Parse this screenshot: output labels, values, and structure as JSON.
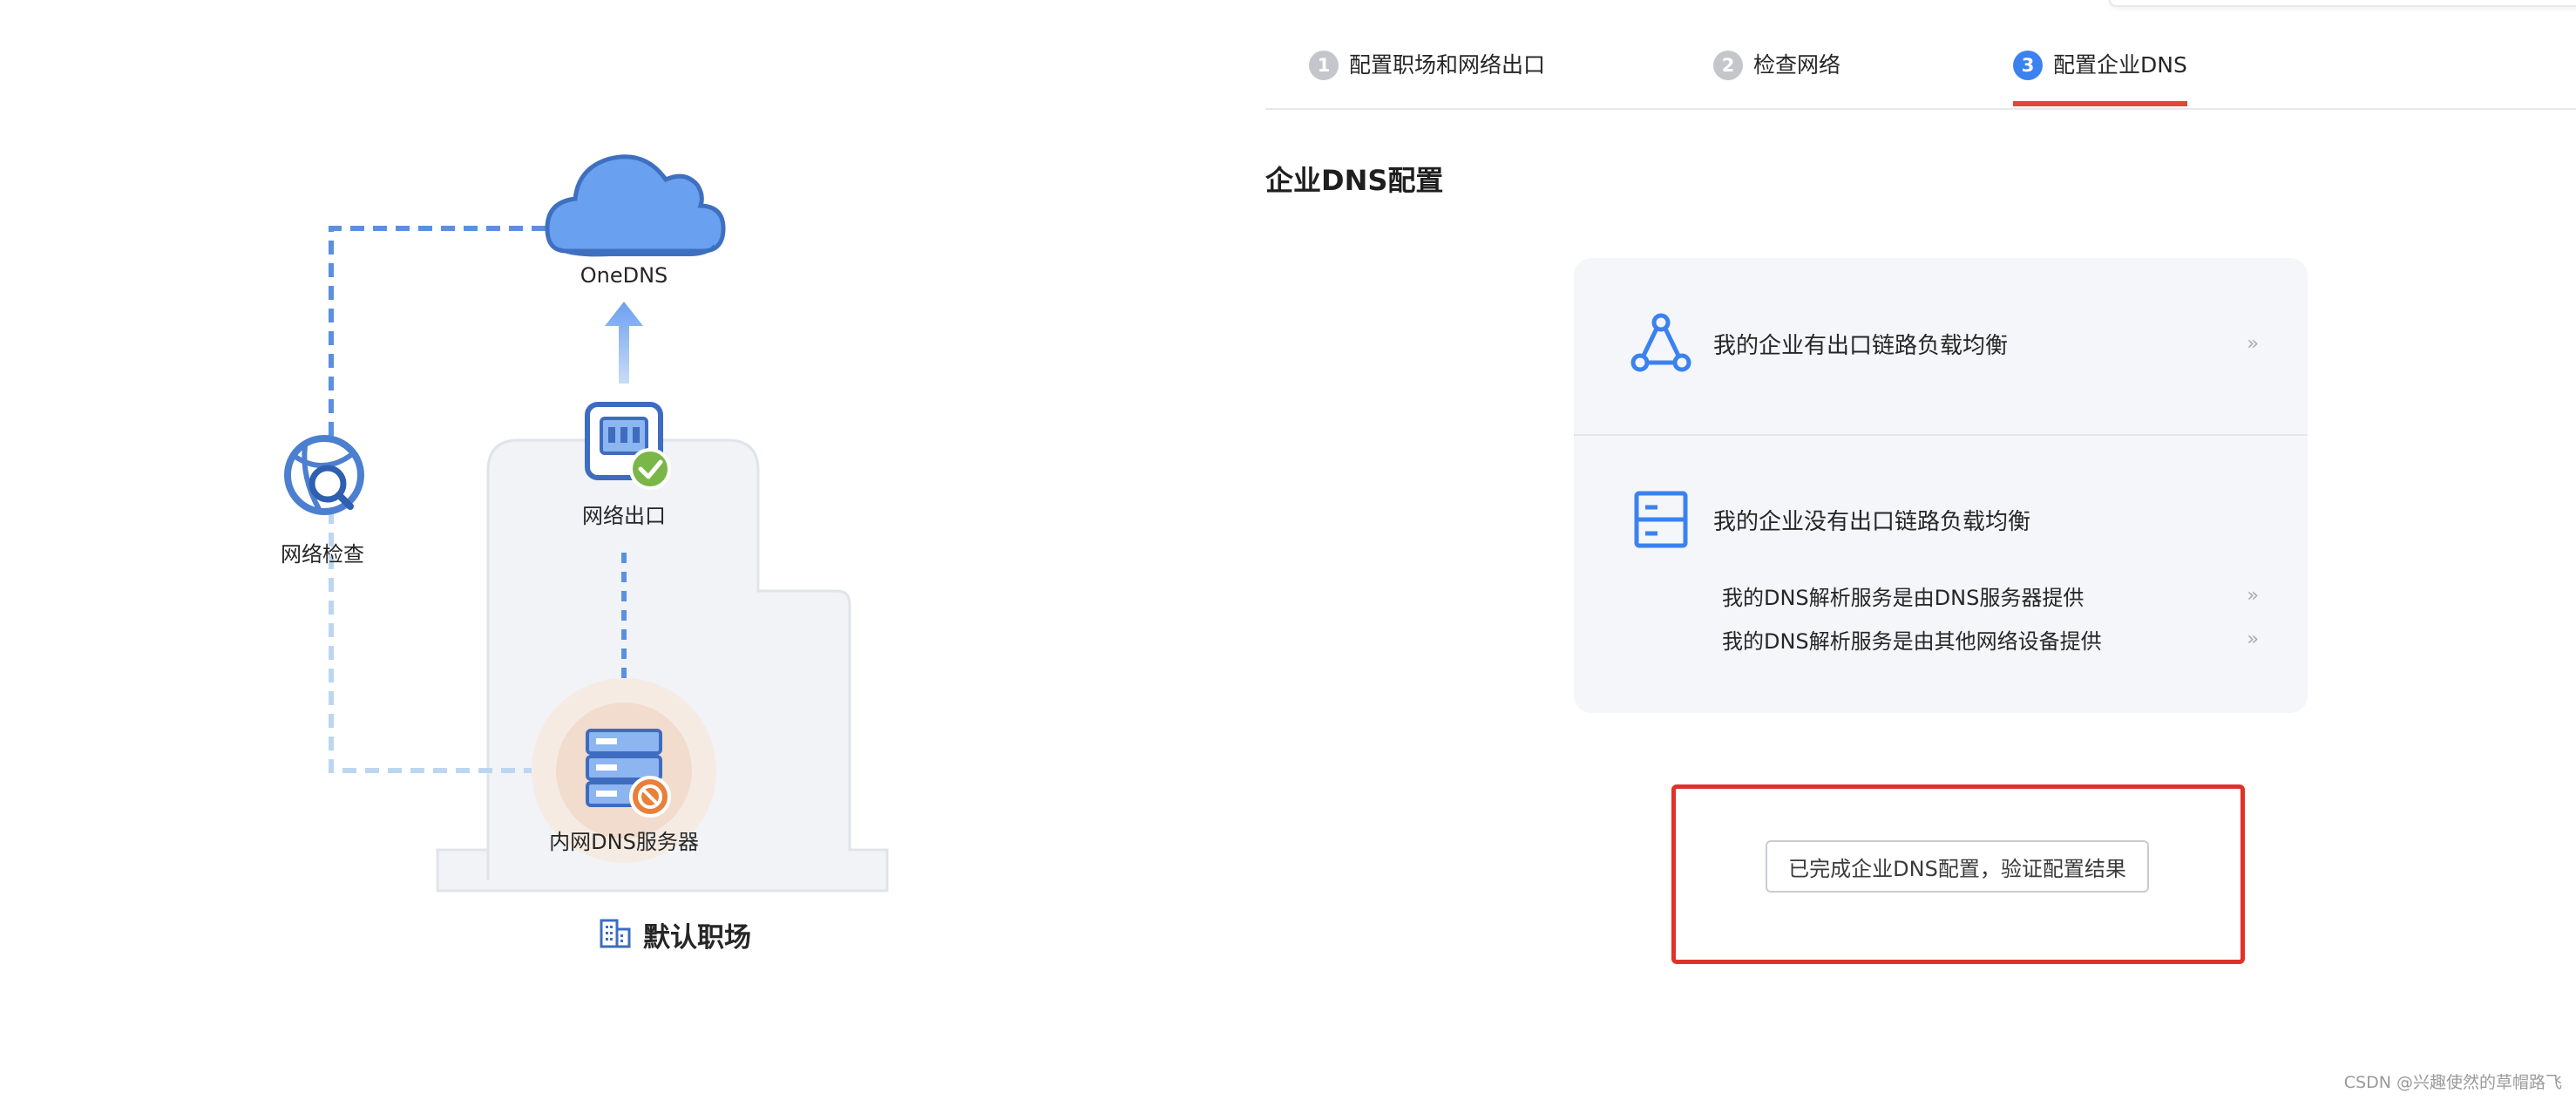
{
  "diagram": {
    "cloud_label": "OneDNS",
    "egress_label": "网络出口",
    "check_label": "网络检查",
    "dns_server_label": "内网DNS服务器",
    "office_name": "默认职场"
  },
  "steps": [
    {
      "num": "1",
      "label": "配置职场和网络出口",
      "active": false
    },
    {
      "num": "2",
      "label": "检查网络",
      "active": false
    },
    {
      "num": "3",
      "label": "配置企业DNS",
      "active": true
    }
  ],
  "section": {
    "title": "企业DNS配置"
  },
  "options": {
    "with_lb": {
      "label": "我的企业有出口链路负载均衡",
      "icon": "triangle-nodes-icon"
    },
    "without_lb": {
      "label": "我的企业没有出口链路负载均衡",
      "icon": "server-rack-icon",
      "sub_options": [
        {
          "label": "我的DNS解析服务是由DNS服务器提供"
        },
        {
          "label": "我的DNS解析服务是由其他网络设备提供"
        }
      ]
    },
    "chevron": "››"
  },
  "verify_button_label": "已完成企业DNS配置，验证配置结果",
  "watermark": "CSDN @兴趣使然的草帽路飞",
  "colors": {
    "accent": "#3b82f0",
    "highlight": "#e0312a",
    "step_inactive": "#c4c6cc",
    "card_bg": "#f4f6f9",
    "check_green": "#7ab648",
    "block_orange": "#e8803a"
  }
}
